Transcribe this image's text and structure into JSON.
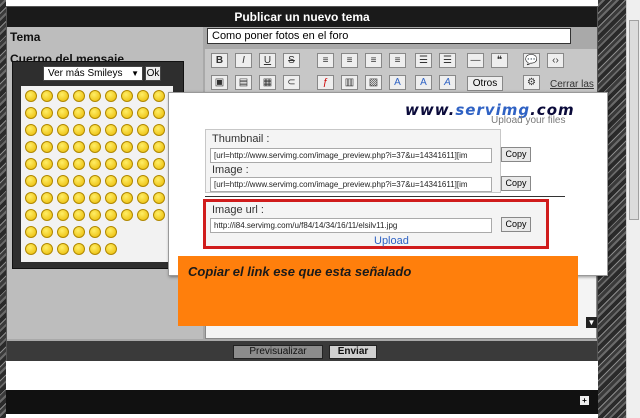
{
  "form": {
    "header_title": "Publicar un nuevo tema",
    "subject_label": "Tema",
    "body_label": "Cuerpo del mensaje",
    "subject_value": "Como poner fotos en el foro"
  },
  "smileys": {
    "select_value": "Ver más Smileys",
    "ok_label": "Ok"
  },
  "toolbar": {
    "otros_label": "Otros",
    "close_link": "Cerrar las"
  },
  "buttons": {
    "preview_label": "Previsualizar",
    "send_label": "Enviar"
  },
  "servimg": {
    "logo_prefix": "www.",
    "logo_brand": "servimg",
    "logo_suffix": ".com",
    "tagline": "Upload your files",
    "thumbnail_label": "Thumbnail :",
    "thumbnail_value": "[url=http://www.servimg.com/image_preview.php?i=37&u=14341611][im",
    "image_label": "Image :",
    "image_value": "[url=http://www.servimg.com/image_preview.php?i=37&u=14341611][im",
    "image_url_label": "Image url :",
    "image_url_value": "http://i84.servimg.com/u/f84/14/34/16/11/elsilv11.jpg",
    "copy_label": "Copy",
    "upload_link": "Upload"
  },
  "annotation": {
    "text": "Copiar el link ese que esta señalado",
    "highlight_color": "#d01c1c",
    "note_color": "#ff7f0c"
  },
  "colors": {
    "header_bg": "#1a1a1a",
    "servimg_blue": "#2f62c4"
  }
}
